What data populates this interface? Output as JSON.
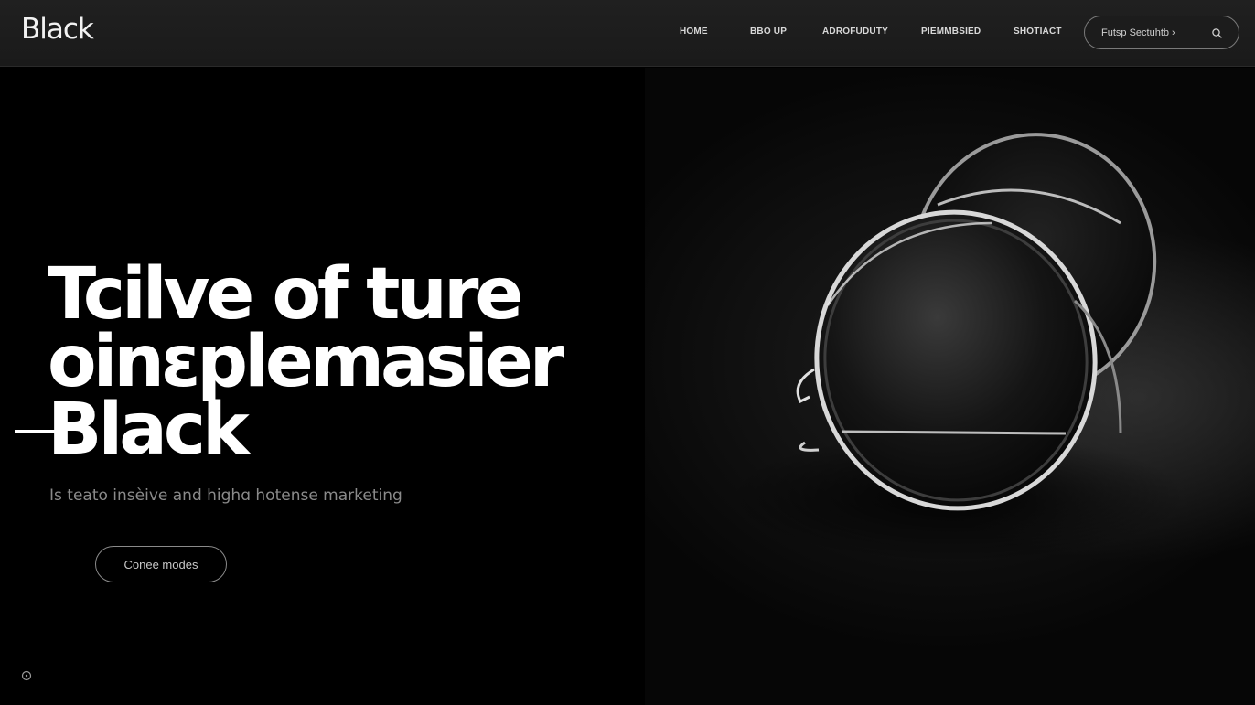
{
  "header": {
    "logo": "Black",
    "nav": [
      {
        "label": "HOME"
      },
      {
        "label": "BBO UP"
      },
      {
        "label": "ADROFUDUTY"
      },
      {
        "label": "PIEMMBSIED"
      },
      {
        "label": "SHOTIACT"
      }
    ],
    "search": {
      "placeholder": "Futsp Sectuhtb ›",
      "icon": "search-icon"
    }
  },
  "hero": {
    "headline_lines": [
      "Tcilve of ture",
      "oinɛplemasier",
      "Black"
    ],
    "subtitle": "Is teato insèive and highɑ hotense marketing",
    "cta_label": "Conee modes",
    "product_image": "sunglasses-photo"
  },
  "footer": {
    "corner_icon": "circle-icon"
  },
  "colors": {
    "background": "#000000",
    "header": "#1e1e1e",
    "text": "#ffffff",
    "muted": "#8a8a8a"
  }
}
